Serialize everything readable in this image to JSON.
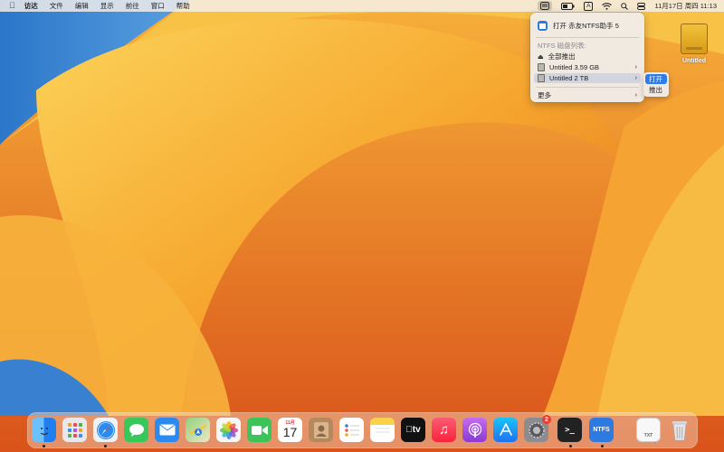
{
  "menubar": {
    "apple_icon": "apple-icon",
    "items": [
      "访达",
      "文件",
      "编辑",
      "显示",
      "前往",
      "窗口",
      "帮助"
    ],
    "status": {
      "input_method": "A",
      "datetime": "11月17日 周四  11:13"
    }
  },
  "dropdown": {
    "open_app": "打开 赤友NTFS助手 5",
    "section_label": "NTFS 磁盘列表:",
    "eject_all": "全部推出",
    "disks": [
      {
        "name": "Untitled",
        "size": "3.59 GB"
      },
      {
        "name": "Untitled",
        "size": "2 TB"
      }
    ],
    "more": "更多",
    "submenu": [
      "打开",
      "推出"
    ]
  },
  "desktop": {
    "icon_label": "Untitled"
  },
  "dock": {
    "calendar_month": "11月",
    "calendar_day": "17",
    "system_prefs_badge": "2",
    "tv_label": "tv",
    "ntfs_label": "NTFS",
    "txt_label": "TXT",
    "apps": [
      {
        "name": "finder",
        "color": "#2f8cf0"
      },
      {
        "name": "launchpad",
        "color": "#e8e8ec"
      },
      {
        "name": "safari",
        "color": "#1e90ff"
      },
      {
        "name": "messages",
        "color": "#37c859"
      },
      {
        "name": "mail",
        "color": "#2a8af0"
      },
      {
        "name": "maps",
        "color": "#5fbf5a"
      },
      {
        "name": "photos",
        "color": "#f5f5f5"
      },
      {
        "name": "facetime",
        "color": "#3cc35a"
      },
      {
        "name": "calendar",
        "color": "#ffffff"
      },
      {
        "name": "contacts",
        "color": "#b48a5c"
      },
      {
        "name": "reminders",
        "color": "#ffffff"
      },
      {
        "name": "notes",
        "color": "#f8d24a"
      },
      {
        "name": "apple-tv",
        "color": "#111111"
      },
      {
        "name": "music",
        "color": "#fa3c4c"
      },
      {
        "name": "podcasts",
        "color": "#a048e0"
      },
      {
        "name": "app-store",
        "color": "#1f86f5"
      },
      {
        "name": "system-preferences",
        "color": "#8c8c90"
      },
      {
        "name": "terminal",
        "color": "#222222"
      },
      {
        "name": "ntfs-assistant",
        "color": "#2d7be0"
      }
    ]
  }
}
